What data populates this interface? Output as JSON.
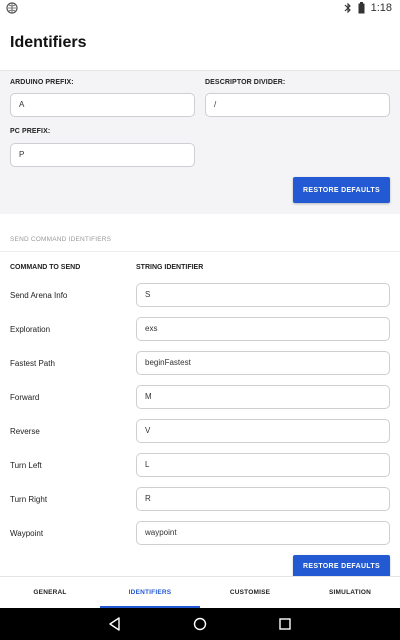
{
  "status_bar": {
    "time": "1:18"
  },
  "app": {
    "title": "Identifiers"
  },
  "prefixes": {
    "arduino_label": "ARDUINO PREFIX:",
    "arduino_value": "A",
    "divider_label": "DESCRIPTOR DIVIDER:",
    "divider_value": "/",
    "pc_label": "PC PREFIX:",
    "pc_value": "P",
    "restore_label": "RESTORE DEFAULTS"
  },
  "commands": {
    "section_caption": "SEND COMMAND IDENTIFIERS",
    "col_command": "COMMAND TO SEND",
    "col_identifier": "STRING IDENTIFIER",
    "rows": [
      {
        "name": "Send Arena Info",
        "value": "S"
      },
      {
        "name": "Exploration",
        "value": "exs"
      },
      {
        "name": "Fastest Path",
        "value": "beginFastest"
      },
      {
        "name": "Forward",
        "value": "M"
      },
      {
        "name": "Reverse",
        "value": "V"
      },
      {
        "name": "Turn Left",
        "value": "L"
      },
      {
        "name": "Turn Right",
        "value": "R"
      },
      {
        "name": "Waypoint",
        "value": "waypoint"
      }
    ],
    "restore_label": "RESTORE DEFAULTS"
  },
  "bottom_nav": {
    "tabs": [
      {
        "label": "GENERAL",
        "active": false
      },
      {
        "label": "IDENTIFIERS",
        "active": true
      },
      {
        "label": "CUSTOMISE",
        "active": false
      },
      {
        "label": "SIMULATION",
        "active": false
      }
    ]
  },
  "colors": {
    "accent": "#2359d2"
  }
}
